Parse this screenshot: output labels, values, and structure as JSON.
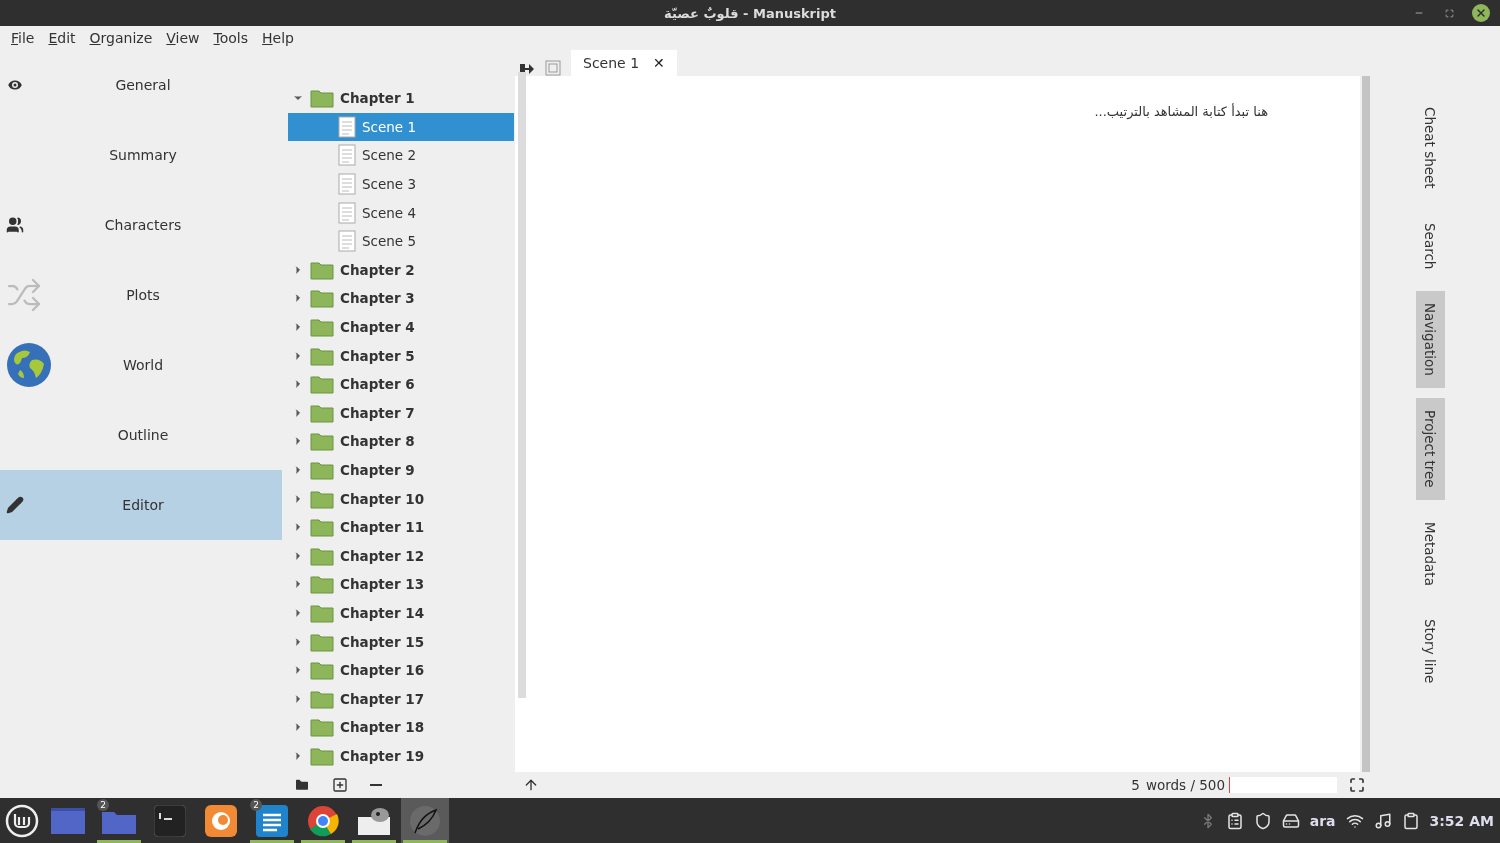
{
  "window": {
    "title": "قلوبٌ عصيّة - Manuskript"
  },
  "menu": [
    {
      "label": "File"
    },
    {
      "label": "Edit"
    },
    {
      "label": "Organize"
    },
    {
      "label": "View"
    },
    {
      "label": "Tools"
    },
    {
      "label": "Help"
    }
  ],
  "sidebar": {
    "items": [
      {
        "label": "General",
        "kind": "eye",
        "selected": false
      },
      {
        "label": "Summary",
        "kind": "none",
        "selected": false
      },
      {
        "label": "Characters",
        "kind": "people",
        "selected": false
      },
      {
        "label": "Plots",
        "kind": "shuffle",
        "selected": false
      },
      {
        "label": "World",
        "kind": "globe",
        "selected": false
      },
      {
        "label": "Outline",
        "kind": "none",
        "selected": false
      },
      {
        "label": "Editor",
        "kind": "pencil",
        "selected": true
      }
    ]
  },
  "tree": {
    "items": [
      {
        "label": "Chapter 1",
        "expanded": true,
        "children": [
          {
            "label": "Scene 1",
            "selected": true
          },
          {
            "label": "Scene 2",
            "selected": false
          },
          {
            "label": "Scene 3",
            "selected": false
          },
          {
            "label": "Scene 4",
            "selected": false
          },
          {
            "label": "Scene 5",
            "selected": false
          }
        ]
      },
      {
        "label": "Chapter 2",
        "expanded": false
      },
      {
        "label": "Chapter 3",
        "expanded": false
      },
      {
        "label": "Chapter 4",
        "expanded": false
      },
      {
        "label": "Chapter 5",
        "expanded": false
      },
      {
        "label": "Chapter 6",
        "expanded": false
      },
      {
        "label": "Chapter 7",
        "expanded": false
      },
      {
        "label": "Chapter 8",
        "expanded": false
      },
      {
        "label": "Chapter 9",
        "expanded": false
      },
      {
        "label": "Chapter 10",
        "expanded": false
      },
      {
        "label": "Chapter 11",
        "expanded": false
      },
      {
        "label": "Chapter 12",
        "expanded": false
      },
      {
        "label": "Chapter 13",
        "expanded": false
      },
      {
        "label": "Chapter 14",
        "expanded": false
      },
      {
        "label": "Chapter 15",
        "expanded": false
      },
      {
        "label": "Chapter 16",
        "expanded": false
      },
      {
        "label": "Chapter 17",
        "expanded": false
      },
      {
        "label": "Chapter 18",
        "expanded": false
      },
      {
        "label": "Chapter 19",
        "expanded": false
      }
    ]
  },
  "editor": {
    "tab": {
      "label": "Scene 1",
      "close": "✕"
    },
    "text": "هنا تبدأ كتابة المشاهد بالترتيب...",
    "word_count": "5",
    "word_goal": "words / 500",
    "progress": {
      "level": 0.01
    }
  },
  "dock": {
    "tabs": [
      {
        "label": "Cheat sheet",
        "selected": false
      },
      {
        "label": "Search",
        "selected": false
      },
      {
        "label": "Navigation",
        "selected": true
      },
      {
        "label": "Project tree",
        "selected": true
      },
      {
        "label": "Metadata",
        "selected": false
      },
      {
        "label": "Story line",
        "selected": false
      }
    ]
  },
  "taskbar": {
    "apps": [
      {
        "kind": "desktop",
        "running": false
      },
      {
        "kind": "folder",
        "running": true,
        "badge": "2"
      },
      {
        "kind": "terminal",
        "running": false
      },
      {
        "kind": "firefox",
        "running": false
      },
      {
        "kind": "notes",
        "running": true,
        "badge": "2"
      },
      {
        "kind": "chrome",
        "running": true
      },
      {
        "kind": "gimp",
        "running": true
      },
      {
        "kind": "quill",
        "running": true,
        "selected": true
      }
    ],
    "keyboard": "ara",
    "clock": "3:52 AM"
  }
}
